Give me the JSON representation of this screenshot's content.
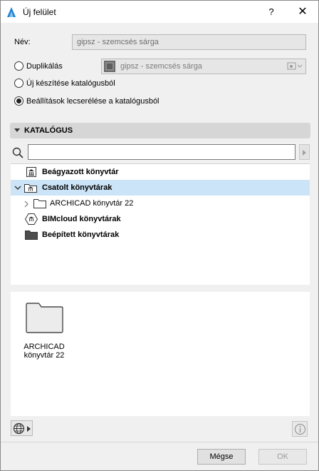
{
  "window": {
    "title": "Új felület",
    "help": "?",
    "close": "✕"
  },
  "name_field": {
    "label": "Név:",
    "value": "gipsz - szemcsés sárga"
  },
  "options": [
    {
      "label": "Duplikálás",
      "checked": false
    },
    {
      "label": "Új készítése katalógusból",
      "checked": false
    },
    {
      "label": "Beállítások lecserélése a katalógusból",
      "checked": true
    }
  ],
  "duplicate_field": {
    "value": "gipsz - szemcsés sárga"
  },
  "catalog": {
    "title": "KATALÓGUS",
    "search": {
      "value": "",
      "placeholder": ""
    },
    "tree": [
      {
        "label": "Beágyazott könyvtár",
        "icon": "embedded-library-icon",
        "bold": true
      },
      {
        "label": "Csatolt könyvtárak",
        "icon": "linked-library-icon",
        "bold": true,
        "expanded": true,
        "selected": true
      },
      {
        "label": "ARCHICAD könyvtár 22",
        "icon": "folder-icon",
        "bold": false
      },
      {
        "label": "BIMcloud könyvtárak",
        "icon": "bimcloud-library-icon",
        "bold": true
      },
      {
        "label": "Beépített könyvtárak",
        "icon": "builtin-folder-icon",
        "bold": true
      }
    ],
    "preview": {
      "line1": "ARCHICAD",
      "line2": "könyvtár 22"
    }
  },
  "buttons": {
    "cancel": "Mégse",
    "ok": "OK"
  },
  "colors": {
    "selection": "#cce4f7",
    "header": "#d6d6d6",
    "accent": "#1e7fd0"
  }
}
